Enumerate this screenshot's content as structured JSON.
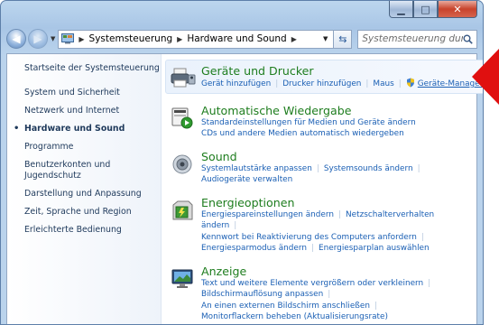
{
  "address": {
    "root_label": "Systemsteuerung",
    "current_label": "Hardware und Sound"
  },
  "search": {
    "placeholder": "Systemsteuerung durchsuchen"
  },
  "sidebar": {
    "items": [
      {
        "label": "Startseite der Systemsteuerung"
      },
      {
        "label": "System und Sicherheit"
      },
      {
        "label": "Netzwerk und Internet"
      },
      {
        "label": "Hardware und Sound",
        "active": true
      },
      {
        "label": "Programme"
      },
      {
        "label": "Benutzerkonten und Jugendschutz"
      },
      {
        "label": "Darstellung und Anpassung"
      },
      {
        "label": "Zeit, Sprache und Region"
      },
      {
        "label": "Erleichterte Bedienung"
      }
    ]
  },
  "categories": {
    "devices": {
      "title": "Geräte und Drucker",
      "links": [
        "Gerät hinzufügen",
        "Drucker hinzufügen",
        "Maus",
        "Geräte-Manager"
      ]
    },
    "autoplay": {
      "title": "Automatische Wiedergabe",
      "links": [
        "Standardeinstellungen für Medien und Geräte ändern",
        "CDs und andere Medien automatisch wiedergeben"
      ]
    },
    "sound": {
      "title": "Sound",
      "links": [
        "Systemlautstärke anpassen",
        "Systemsounds ändern",
        "Audiogeräte verwalten"
      ]
    },
    "power": {
      "title": "Energieoptionen",
      "links": [
        "Energiespareinstellungen ändern",
        "Netzschalterverhalten ändern",
        "Kennwort bei Reaktivierung des Computers anfordern",
        "Energiesparmodus ändern",
        "Energiesparplan auswählen"
      ]
    },
    "display": {
      "title": "Anzeige",
      "links": [
        "Text und weitere Elemente vergrößern oder verkleinern",
        "Bildschirmauflösung anpassen",
        "An einen externen Bildschirm anschließen",
        "Monitorflackern beheben (Aktualisierungsrate)"
      ]
    }
  },
  "colors": {
    "category_title": "#1e7d1e",
    "link": "#1a5fb4",
    "annotation_arrow": "#e01010"
  }
}
